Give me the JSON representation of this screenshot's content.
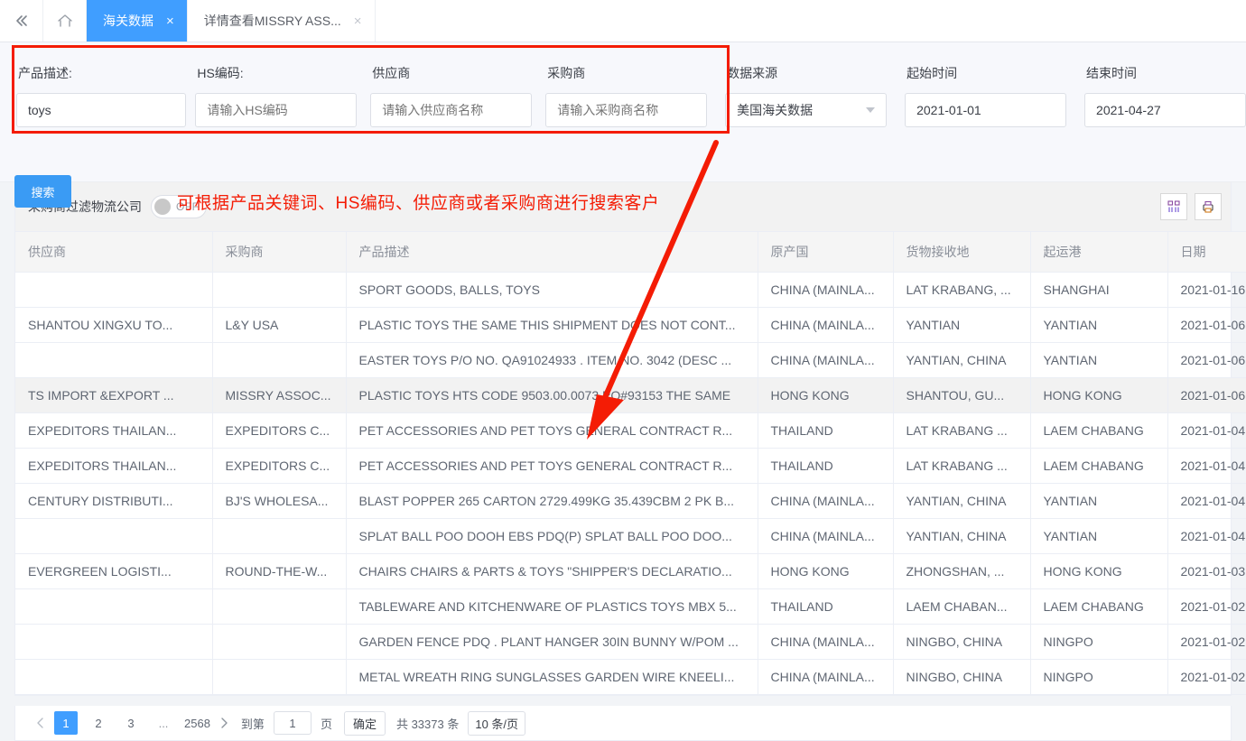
{
  "tabs": {
    "collapse_icon": "double-chevron-left-icon",
    "home_icon": "home-icon",
    "items": [
      {
        "label": "海关数据",
        "active": true,
        "close": "×"
      },
      {
        "label": "详情查看MISSRY ASS...",
        "active": false,
        "close": "×"
      }
    ]
  },
  "search": {
    "labels": {
      "product": "产品描述:",
      "hs": "HS编码:",
      "supplier": "供应商",
      "buyer": "采购商",
      "source": "数据来源",
      "start": "起始时间",
      "end": "结束时间"
    },
    "values": {
      "product": "toys",
      "hs": "",
      "supplier": "",
      "buyer": "",
      "source": "美国海关数据",
      "start": "2021-01-01",
      "end": "2021-04-27"
    },
    "placeholders": {
      "product": "请输入产品描述",
      "hs": "请输入HS编码",
      "supplier": "请输入供应商名称",
      "buyer": "请输入采购商名称"
    },
    "search_button": "搜索",
    "annotation": "可根据产品关键词、HS编码、供应商或者采购商进行搜索客户",
    "annotation_color": "#f41c05"
  },
  "toolbar": {
    "filter_label": "采购商过滤物流公司",
    "switch_state": "OFF",
    "columns_icon": "columns-settings-icon",
    "export_icon": "export-printer-icon"
  },
  "table": {
    "headers": [
      "供应商",
      "采购商",
      "产品描述",
      "原产国",
      "货物接收地",
      "起运港",
      "日期"
    ],
    "rows": [
      {
        "supplier": "",
        "buyer": "",
        "product": "SPORT GOODS, BALLS, TOYS",
        "origin": "CHINA (MAINLA...",
        "receipt": "LAT KRABANG, ...",
        "port": "SHANGHAI",
        "date": "2021-01-16",
        "highlight": false
      },
      {
        "supplier": "SHANTOU XINGXU TO...",
        "buyer": "L&Y USA",
        "product": "PLASTIC TOYS THE SAME THIS SHIPMENT DOES NOT CONT...",
        "origin": "CHINA (MAINLA...",
        "receipt": "YANTIAN",
        "port": "YANTIAN",
        "date": "2021-01-06",
        "highlight": false
      },
      {
        "supplier": "",
        "buyer": "",
        "product": "EASTER TOYS P/O NO. QA91024933 . ITEM NO. 3042 (DESC ...",
        "origin": "CHINA (MAINLA...",
        "receipt": "YANTIAN, CHINA",
        "port": "YANTIAN",
        "date": "2021-01-06",
        "highlight": false
      },
      {
        "supplier": "TS IMPORT &EXPORT ...",
        "buyer": "MISSRY ASSOC...",
        "product": "PLASTIC TOYS HTS CODE 9503.00.0073 PO#93153 THE SAME",
        "origin": "HONG KONG",
        "receipt": "SHANTOU, GU...",
        "port": "HONG KONG",
        "date": "2021-01-06",
        "highlight": true
      },
      {
        "supplier": "EXPEDITORS THAILAN...",
        "buyer": "EXPEDITORS C...",
        "product": "PET ACCESSORIES AND PET TOYS GENERAL CONTRACT R...",
        "origin": "THAILAND",
        "receipt": "LAT KRABANG ...",
        "port": "LAEM CHABANG",
        "date": "2021-01-04",
        "highlight": false
      },
      {
        "supplier": "EXPEDITORS THAILAN...",
        "buyer": "EXPEDITORS C...",
        "product": "PET ACCESSORIES AND PET TOYS GENERAL CONTRACT R...",
        "origin": "THAILAND",
        "receipt": "LAT KRABANG ...",
        "port": "LAEM CHABANG",
        "date": "2021-01-04",
        "highlight": false
      },
      {
        "supplier": "CENTURY DISTRIBUTI...",
        "buyer": "BJ'S WHOLESA...",
        "product": "BLAST POPPER 265 CARTON 2729.499KG 35.439CBM 2 PK B...",
        "origin": "CHINA (MAINLA...",
        "receipt": "YANTIAN, CHINA",
        "port": "YANTIAN",
        "date": "2021-01-04",
        "highlight": false
      },
      {
        "supplier": "",
        "buyer": "",
        "product": "SPLAT BALL POO DOOH EBS PDQ(P) SPLAT BALL POO DOO...",
        "origin": "CHINA (MAINLA...",
        "receipt": "YANTIAN, CHINA",
        "port": "YANTIAN",
        "date": "2021-01-04",
        "highlight": false
      },
      {
        "supplier": "EVERGREEN LOGISTI...",
        "buyer": "ROUND-THE-W...",
        "product": "CHAIRS CHAIRS & PARTS & TOYS \"SHIPPER'S DECLARATIO...",
        "origin": "HONG KONG",
        "receipt": "ZHONGSHAN, ...",
        "port": "HONG KONG",
        "date": "2021-01-03",
        "highlight": false
      },
      {
        "supplier": "",
        "buyer": "",
        "product": "TABLEWARE AND KITCHENWARE OF PLASTICS TOYS MBX 5...",
        "origin": "THAILAND",
        "receipt": "LAEM CHABAN...",
        "port": "LAEM CHABANG",
        "date": "2021-01-02",
        "highlight": false
      },
      {
        "supplier": "",
        "buyer": "",
        "product": "GARDEN FENCE PDQ . PLANT HANGER 30IN BUNNY W/POM ...",
        "origin": "CHINA (MAINLA...",
        "receipt": "NINGBO, CHINA",
        "port": "NINGPO",
        "date": "2021-01-02",
        "highlight": false
      },
      {
        "supplier": "",
        "buyer": "",
        "product": "METAL WREATH RING SUNGLASSES GARDEN WIRE KNEELI...",
        "origin": "CHINA (MAINLA...",
        "receipt": "NINGBO, CHINA",
        "port": "NINGPO",
        "date": "2021-01-02",
        "highlight": false
      }
    ]
  },
  "pagination": {
    "prev_icon": "chevron-left-icon",
    "next_icon": "chevron-right-icon",
    "pages": [
      "1",
      "2",
      "3",
      "...",
      "2568"
    ],
    "current_page": "1",
    "goto_prefix": "到第",
    "goto_value": "1",
    "goto_suffix": "页",
    "confirm": "确定",
    "total": "共 33373 条",
    "page_size": "10 条/页"
  }
}
